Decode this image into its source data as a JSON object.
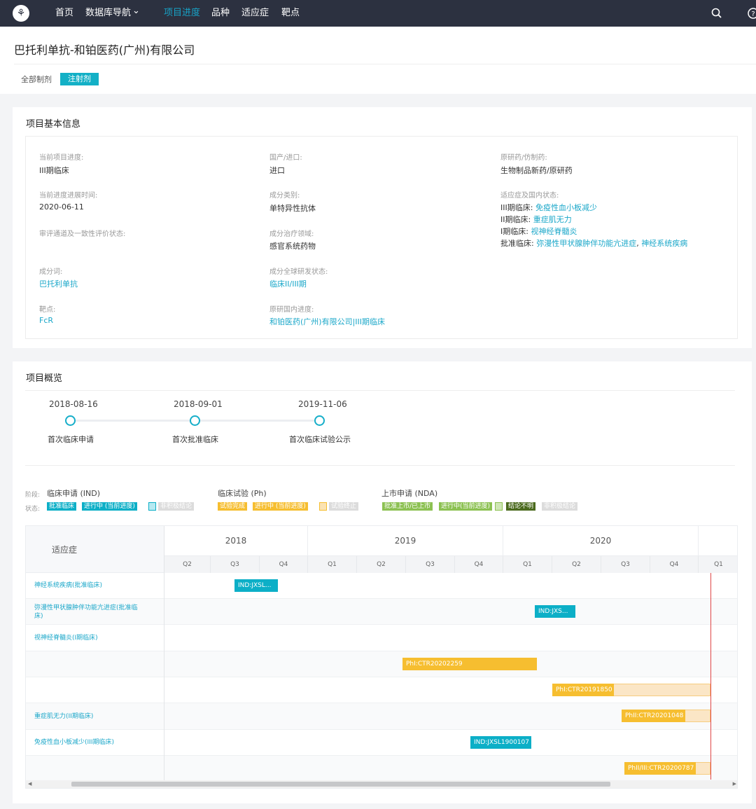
{
  "nav": {
    "items": [
      "首页",
      "数据库导航",
      "项目进度",
      "品种",
      "适应症",
      "靶点"
    ],
    "dropdown_mark": "⌄",
    "icons": [
      "logo-icon",
      "search-icon",
      "help-icon"
    ]
  },
  "page": {
    "title": "巴托利单抗-和铂医药(广州)有限公司",
    "tab_all": "全部制剂",
    "tab_injection": "注射剂"
  },
  "basic_info": {
    "title": "项目基本信息",
    "current_stage_label": "当前项目进度:",
    "current_stage_value": "III期临床",
    "origin_label": "国产/进口:",
    "origin_value": "进口",
    "original_generic_label": "原研药/仿制药:",
    "original_generic_value": "生物制品新药/原研药",
    "stage_time_label": "当前进度进展时间:",
    "stage_time_value": "2020-06-11",
    "category_label": "成分类别:",
    "category_value": "单特异性抗体",
    "indications_label": "适应症及国内状态:",
    "indications": [
      {
        "status": "III期临床:",
        "items": [
          "免疫性血小板减少"
        ]
      },
      {
        "status": "II期临床:",
        "items": [
          "重症肌无力"
        ]
      },
      {
        "status": "I期临床:",
        "items": [
          "视神经脊髓炎"
        ]
      },
      {
        "status": "批准临床:",
        "items": [
          "弥漫性甲状腺肿伴功能亢进症",
          "神经系统疾病"
        ]
      }
    ],
    "indication_sep": ",",
    "review_label": "审评通道及一致性评价状态:",
    "therapeutic_label": "成分治疗领域:",
    "therapeutic_value": "感官系统药物",
    "ingredient_label": "成分词:",
    "ingredient_value": "巴托利单抗",
    "global_status_label": "成分全球研发状态:",
    "global_status_value": "临床II/III期",
    "target_label": "靶点:",
    "target_value": "FcR",
    "domestic_progress_label": "原研国内进度:",
    "domestic_progress_value": "和铂医药(广州)有限公司|III期临床"
  },
  "overview": {
    "title": "项目概览",
    "milestones": [
      {
        "date": "2018-08-16",
        "label": "首次临床申请"
      },
      {
        "date": "2018-09-01",
        "label": "首次批准临床"
      },
      {
        "date": "2019-11-06",
        "label": "首次临床试验公示"
      }
    ],
    "legend": {
      "stage_label": "阶段:",
      "status_label": "状态:",
      "ind_title": "临床申请 (IND)",
      "ph_title": "临床试验 (Ph)",
      "nda_title": "上市申请 (NDA)",
      "ind_chips": [
        "批准临床",
        "进行中 (当前进度)",
        "",
        "非积极结论"
      ],
      "ph_chips": [
        "试验完成",
        "进行中 (当前进度)",
        "",
        "试验终止"
      ],
      "nda_chips": [
        "批准上市/已上市",
        "进行中(当前进度)",
        "",
        "结论不明",
        "非积极结论"
      ],
      "colors": {
        "teal": "#0cafc7",
        "teal_light": "#b6e9f1",
        "grey": "#dcdcdc",
        "gold": "#f6be30",
        "gold_light": "#fbe3b3",
        "green": "#8cc152",
        "green_light": "#cfe6b5",
        "dark_green": "#4b6a1e"
      }
    },
    "gantt": {
      "header": "适应症",
      "years": [
        "2018",
        "2019",
        "2020"
      ],
      "quarters": [
        "Q2",
        "Q3",
        "Q4",
        "Q1",
        "Q2",
        "Q3",
        "Q4",
        "Q1",
        "Q2",
        "Q3",
        "Q4",
        "Q1"
      ],
      "rows": [
        {
          "label": "神经系统疾病(批准临床)",
          "bar": "IND:JXSL..."
        },
        {
          "label": "弥漫性甲状腺肿伴功能亢进症(批准临床)",
          "bar": "IND:JXS..."
        },
        {
          "label": "视神经脊髓炎(I期临床)",
          "bar": ""
        },
        {
          "label": "",
          "bar": "PhI:CTR20202259"
        },
        {
          "label": "",
          "bar": "PhI:CTR20191850"
        },
        {
          "label": "重症肌无力(II期临床)",
          "bar": "PhII:CTR20201048"
        },
        {
          "label": "免疫性血小板减少(III期临床)",
          "bar": "IND:JXSL1900107"
        },
        {
          "label": "",
          "bar": "PhII/III:CTR20200787"
        }
      ]
    }
  }
}
